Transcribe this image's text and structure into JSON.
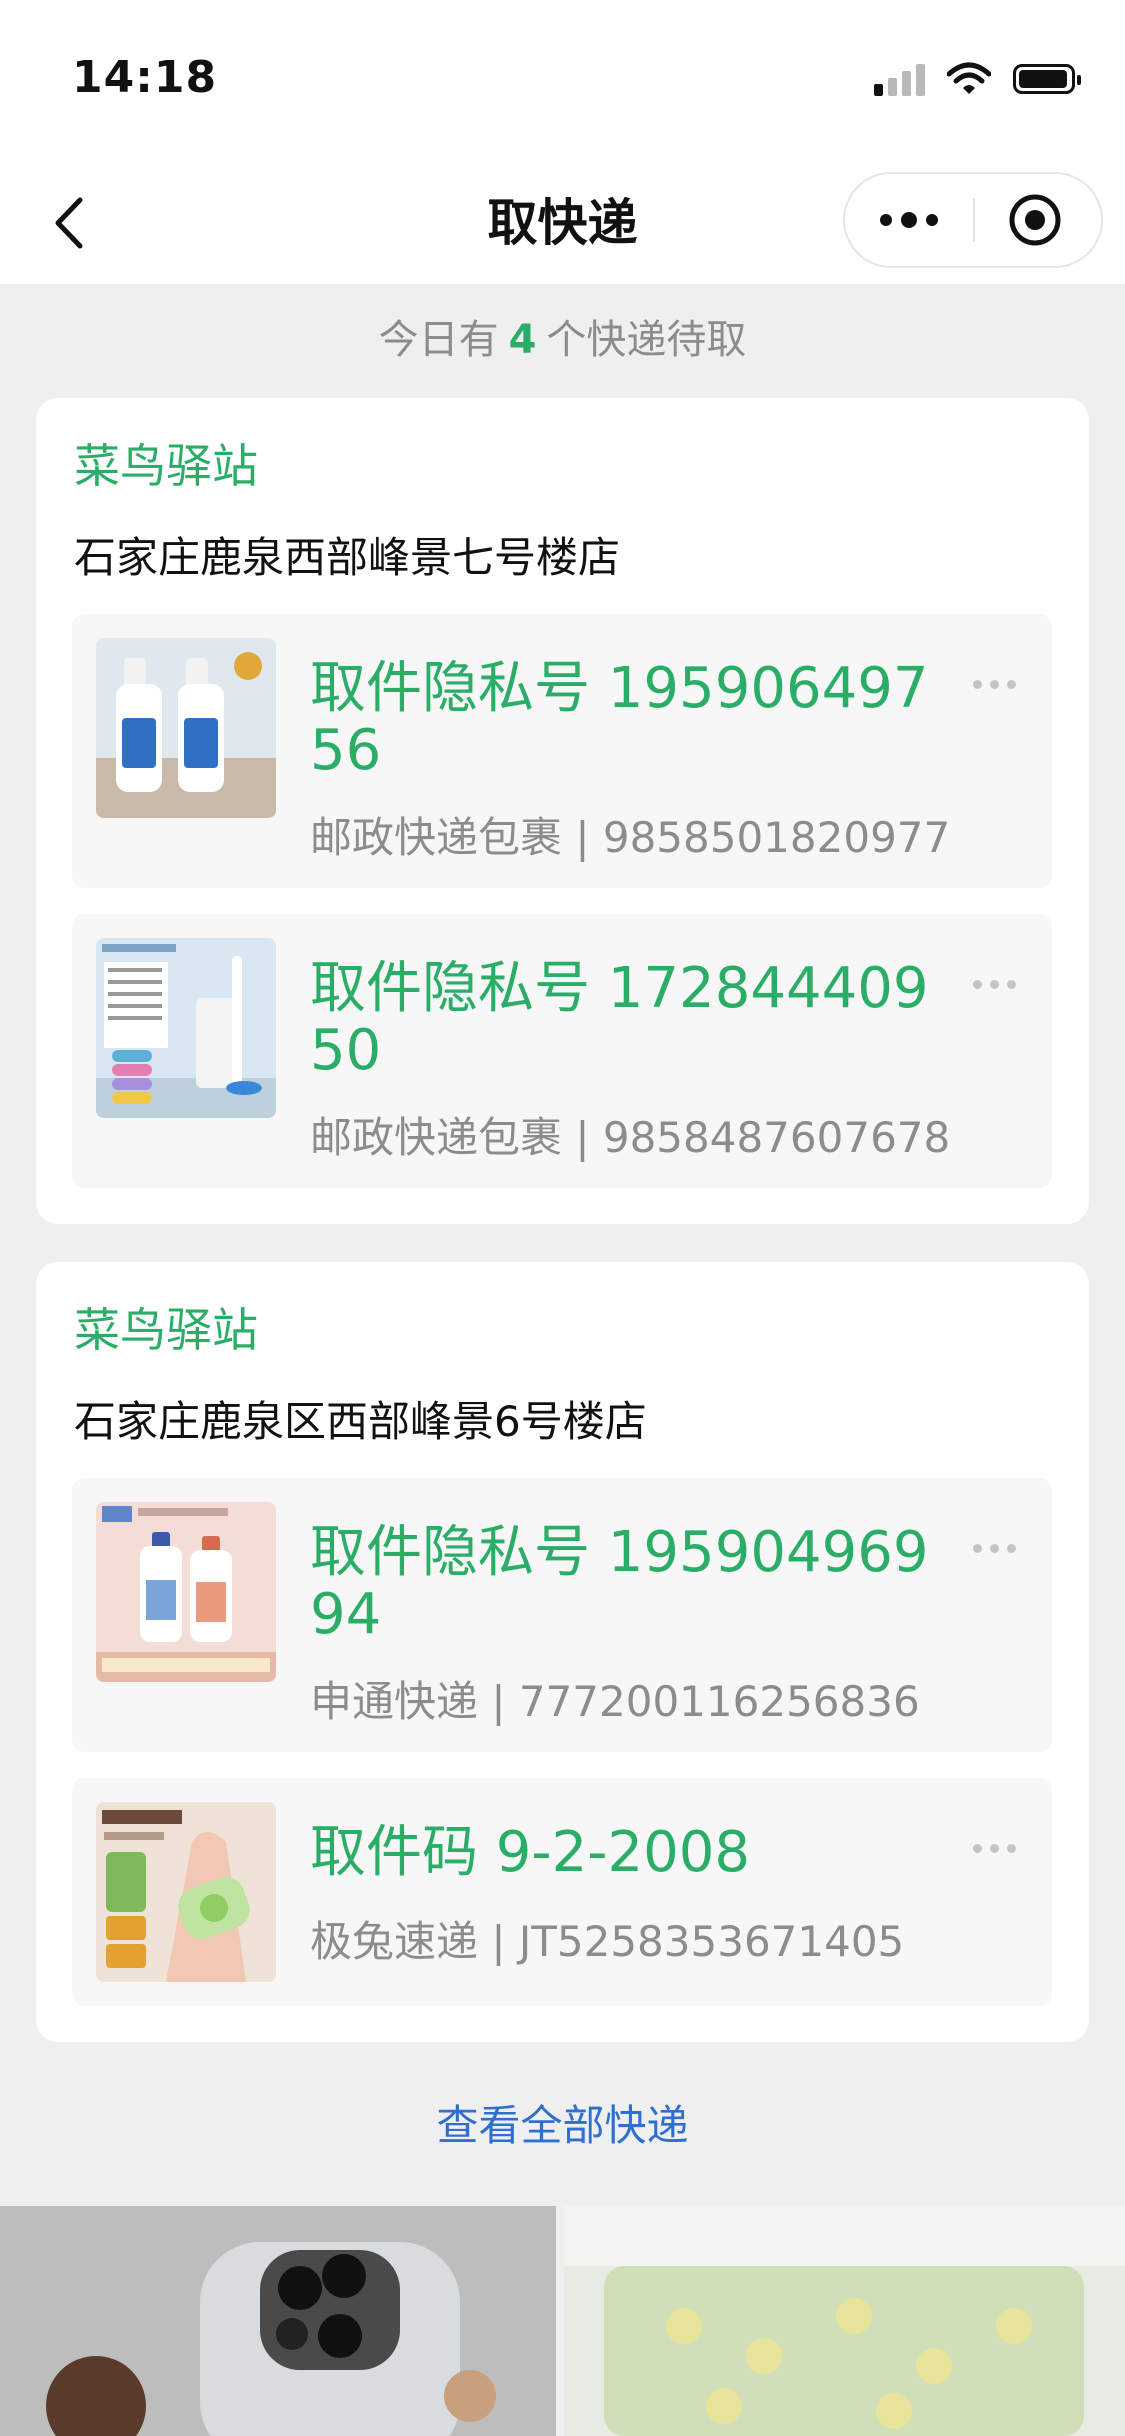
{
  "status_bar": {
    "time": "14:18"
  },
  "nav": {
    "title": "取快递"
  },
  "summary": {
    "prefix": "今日有",
    "count": "4",
    "suffix": "个快递待取"
  },
  "stations": [
    {
      "name": "菜鸟驿站",
      "address": "石家庄鹿泉西部峰景七号楼店",
      "parcels": [
        {
          "code": "取件隐私号 19590649756",
          "carrier": "邮政快递包裹 | 9858501820977"
        },
        {
          "code": "取件隐私号 17284440950",
          "carrier": "邮政快递包裹 | 9858487607678"
        }
      ]
    },
    {
      "name": "菜鸟驿站",
      "address": "石家庄鹿泉区西部峰景6号楼店",
      "parcels": [
        {
          "code": "取件隐私号 19590496994",
          "carrier": "申通快递 | 777200116256836"
        },
        {
          "code": "取件码 9-2-2008",
          "carrier": "极兔速递 | JT5258353671405"
        }
      ]
    }
  ],
  "view_all": "查看全部快递",
  "colors": {
    "accent": "#2aae67",
    "link": "#2e6fd0",
    "muted": "#8c8c8c"
  },
  "icons": [
    "back-icon",
    "more-icon",
    "close-mini-program-icon",
    "more-dots-icon",
    "signal-icon",
    "wifi-icon",
    "battery-icon"
  ]
}
